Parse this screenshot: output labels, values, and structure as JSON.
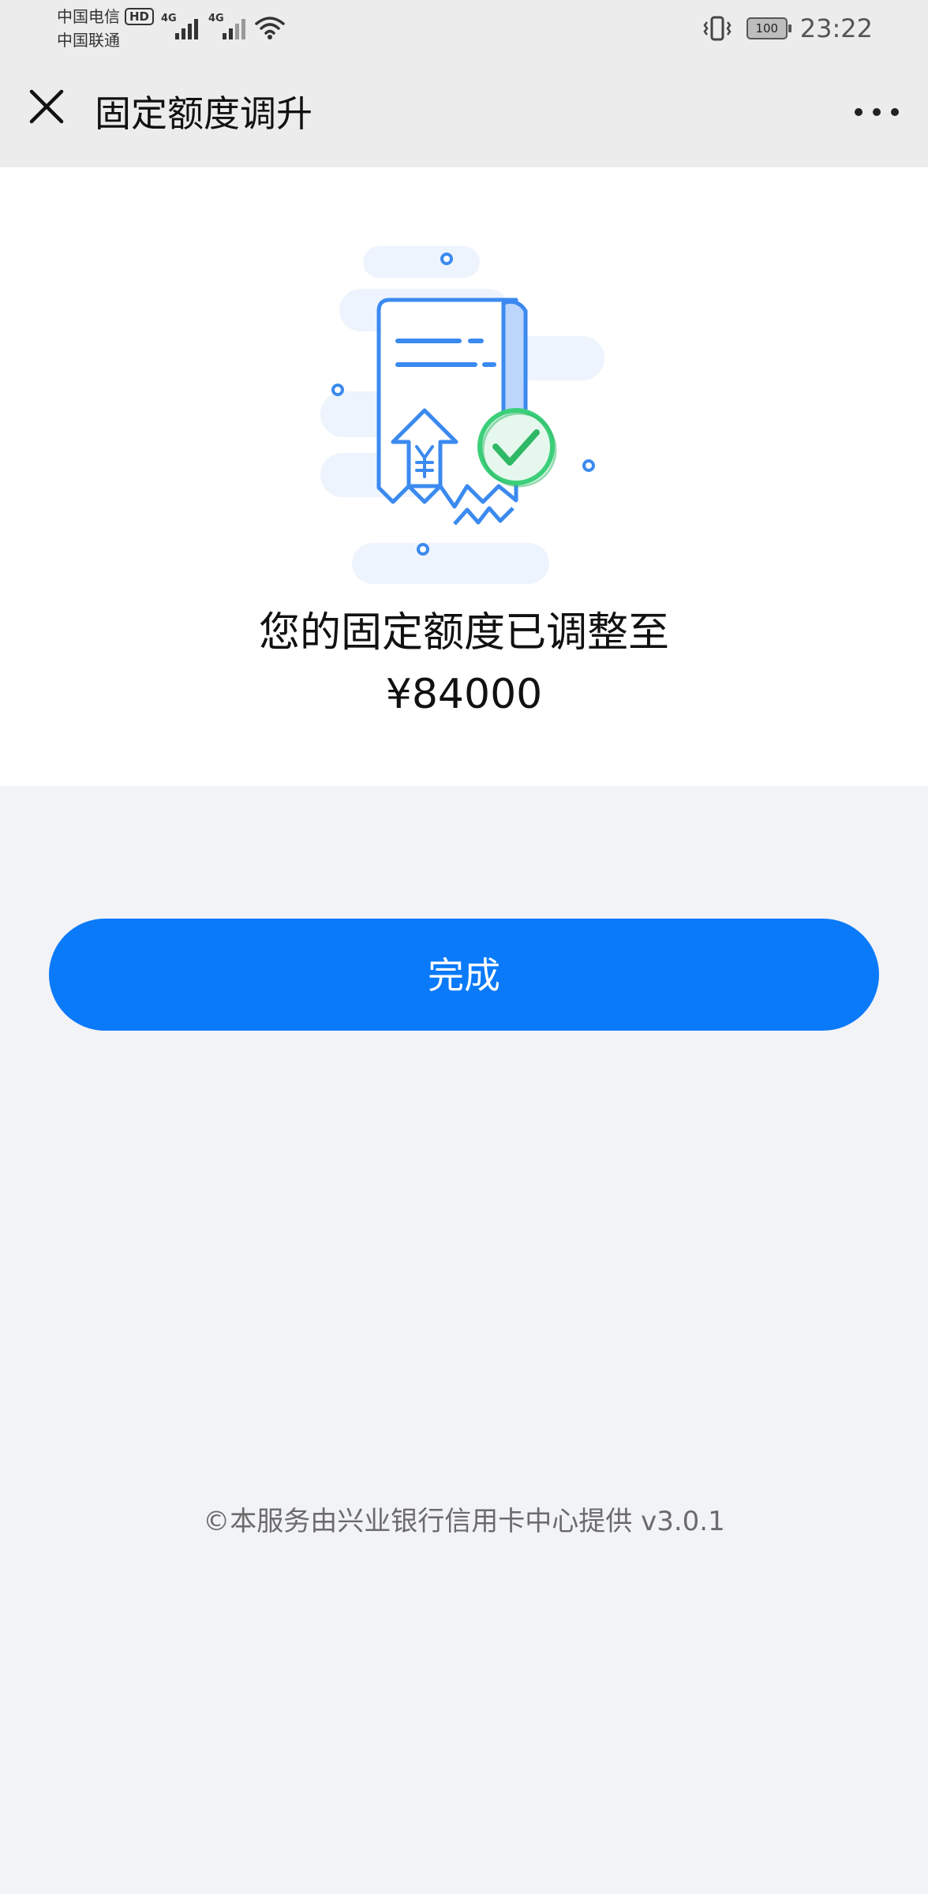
{
  "status_bar": {
    "carrier_1": "中国电信",
    "hd_badge": "HD",
    "carrier_2": "中国联通",
    "signal_1_label": "4G",
    "signal_2_label": "4G",
    "battery_level": "100",
    "time": "23:22",
    "icons": [
      "signal-icon",
      "wifi-icon",
      "vibrate-icon",
      "battery-icon"
    ]
  },
  "nav": {
    "title": "固定额度调升",
    "close_icon": "close-icon",
    "more_icon": "more-icon"
  },
  "result": {
    "illustration": "receipt-success-illustration",
    "message": "您的固定额度已调整至",
    "amount": "¥84000"
  },
  "actions": {
    "done_label": "完成"
  },
  "footer": {
    "text": "©本服务由兴业银行信用卡中心提供 v3.0.1"
  },
  "colors": {
    "accent": "#0a7af9",
    "success": "#3ccf7a",
    "illustration_blue": "#3b8af0",
    "page_background": "#f2f3f7",
    "card_background": "#ffffff"
  }
}
